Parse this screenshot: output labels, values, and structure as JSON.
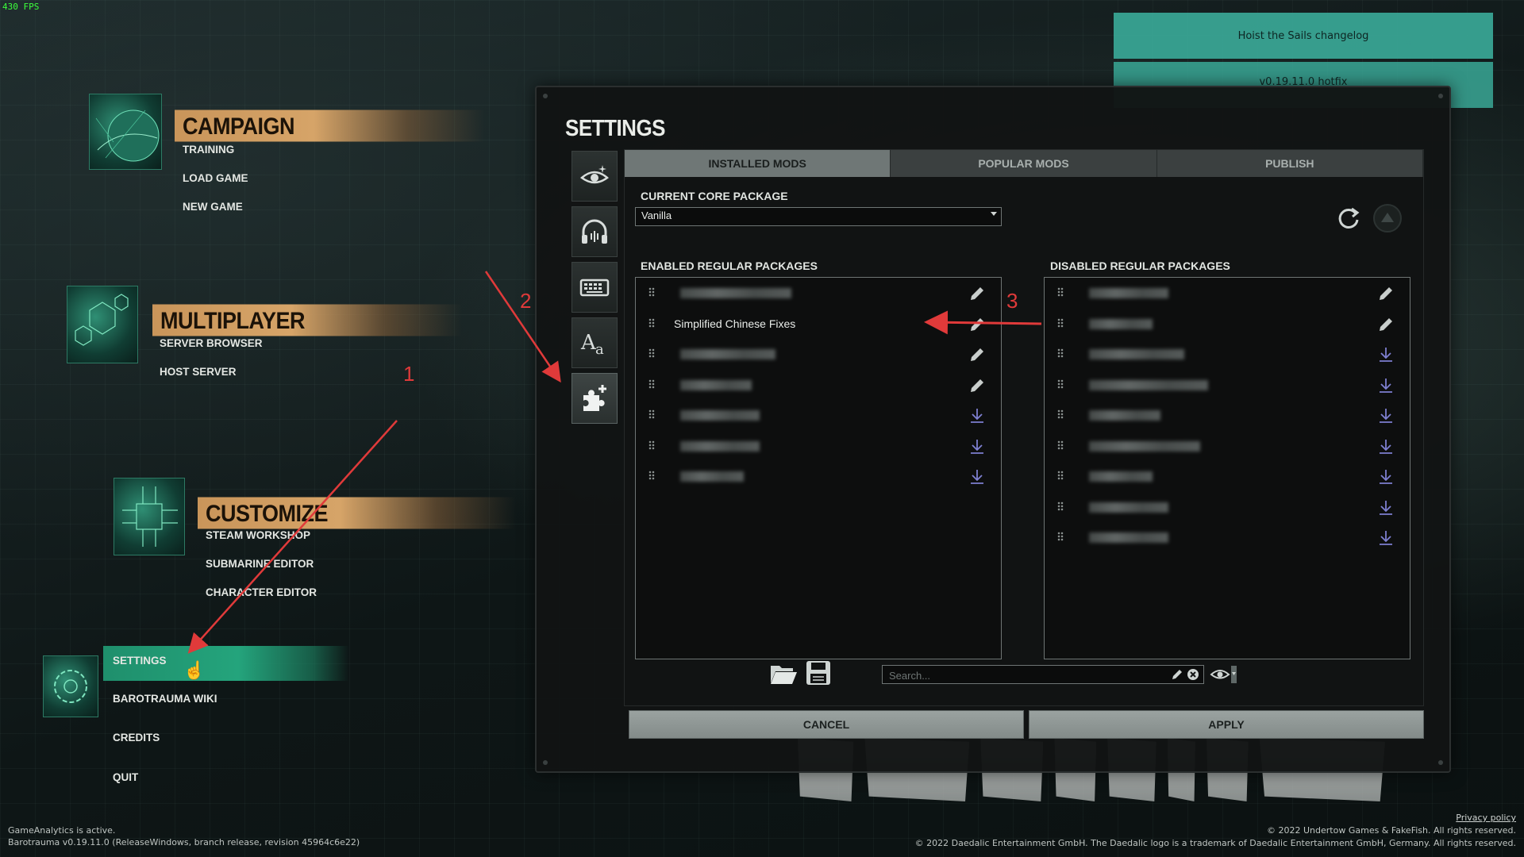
{
  "fps": "430 FPS",
  "main_menu": {
    "campaign": {
      "title": "CAMPAIGN",
      "items": [
        "TRAINING",
        "LOAD GAME",
        "NEW GAME"
      ]
    },
    "multiplayer": {
      "title": "MULTIPLAYER",
      "items": [
        "SERVER BROWSER",
        "HOST SERVER"
      ]
    },
    "customize": {
      "title": "CUSTOMIZE",
      "items": [
        "STEAM WORKSHOP",
        "SUBMARINE EDITOR",
        "CHARACTER EDITOR"
      ]
    },
    "misc": {
      "items": [
        "SETTINGS",
        "BAROTRAUMA WIKI",
        "CREDITS",
        "QUIT"
      ]
    }
  },
  "changelog": {
    "title": "Hoist the Sails changelog",
    "second": "v0.19.11.0 hotfix"
  },
  "settings": {
    "title": "SETTINGS",
    "side_tabs": [
      "eye-icon",
      "headphones-icon",
      "keyboard-icon",
      "font-icon",
      "mods-icon"
    ],
    "tabs": [
      "INSTALLED MODS",
      "POPULAR MODS",
      "PUBLISH"
    ],
    "core_label": "CURRENT CORE PACKAGE",
    "core_value": "Vanilla",
    "enabled_label": "ENABLED REGULAR PACKAGES",
    "disabled_label": "DISABLED REGULAR PACKAGES",
    "enabled": [
      {
        "name": "",
        "action": "edit"
      },
      {
        "name": "Simplified Chinese Fixes",
        "action": "edit"
      },
      {
        "name": "",
        "action": "edit"
      },
      {
        "name": "",
        "action": "edit"
      },
      {
        "name": "",
        "action": "download"
      },
      {
        "name": "",
        "action": "download"
      },
      {
        "name": "",
        "action": "download"
      }
    ],
    "disabled": [
      {
        "name": "",
        "action": "edit"
      },
      {
        "name": "",
        "action": "edit"
      },
      {
        "name": "",
        "action": "download"
      },
      {
        "name": "",
        "action": "download"
      },
      {
        "name": "",
        "action": "download"
      },
      {
        "name": "",
        "action": "download"
      },
      {
        "name": "",
        "action": "download"
      },
      {
        "name": "",
        "action": "download"
      },
      {
        "name": "",
        "action": "download"
      }
    ],
    "search_placeholder": "Search...",
    "cancel": "CANCEL",
    "apply": "APPLY"
  },
  "annotations": [
    "1",
    "2",
    "3"
  ],
  "footer": {
    "analytics": "GameAnalytics is active.",
    "version": "Barotrauma v0.19.11.0 (ReleaseWindows, branch release, revision 45964c6e22)",
    "privacy": "Privacy policy",
    "copyright1": "© 2022 Undertow Games & FakeFish. All rights reserved.",
    "copyright2": "© 2022 Daedalic Entertainment GmbH. The Daedalic logo is a trademark of Daedalic Entertainment GmbH, Germany. All rights reserved."
  },
  "colors": {
    "accent_green": "#24a47c",
    "accent_orange": "#d6a468",
    "annotation_red": "#e03a3a",
    "changelog": "#3aa897"
  }
}
